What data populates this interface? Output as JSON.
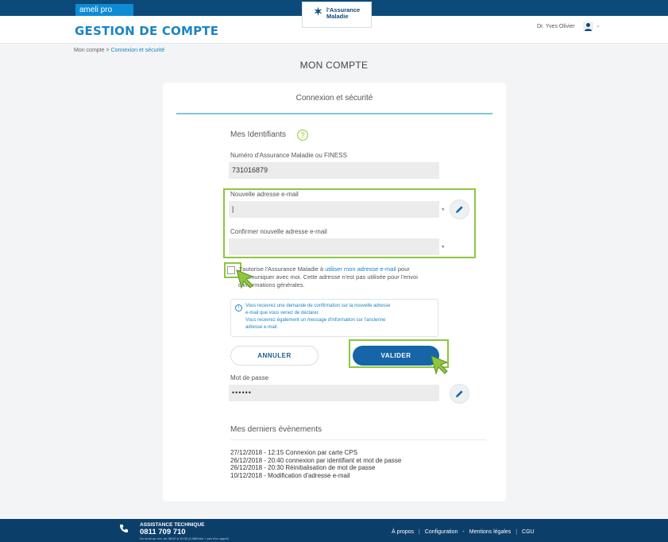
{
  "brand": {
    "tag": "ameli pro",
    "logo_line1": "l'Assurance",
    "logo_line2": "Maladie"
  },
  "header": {
    "title": "GESTION DE COMPTE",
    "user_name": "Dr. Yves Olivier"
  },
  "breadcrumb": {
    "root": "Mon compte",
    "separator": ">",
    "current": "Connexion et sécurité"
  },
  "page_title": "MON COMPTE",
  "card": {
    "title": "Connexion et sécurité",
    "identifiers_label": "Mes Identifiants",
    "help_glyph": "?",
    "number_label": "Numéro d'Assurance Maladie ou FINESS",
    "number_value": "731016879",
    "new_email_label": "Nouvelle adresse e-mail",
    "new_email_value": "|",
    "confirm_email_label": "Confirmer nouvelle adresse e-mail",
    "confirm_email_value": "",
    "required_mark": "*",
    "consent_pre": "J'autorise l'Assurance Maladie à ",
    "consent_link": "utiliser mon adresse e-mail",
    "consent_post": " pour communiquer avec moi. Cette adresse n'est pas utilisée pour l'envoi d'informations générales.",
    "info_glyph": "i",
    "info_line1": "Vous recevrez une demande de confirmation sur la nouvelle adresse",
    "info_line2": "e-mail que vous venez de déclarer.",
    "info_line3": "Vous recevrez également un message d'information sur l'ancienne",
    "info_line4": "adresse e-mail.",
    "cancel_label": "ANNULER",
    "validate_label": "VALIDER",
    "password_label": "Mot de passe",
    "password_value": "••••••",
    "events_title": "Mes derniers évènements",
    "events": [
      "27/12/2018 - 12:15 Connexion par carte CPS",
      "26/12/2018 - 20:40 connexion par identifiant et mot de passe",
      "26/12/2018 - 20:30 Réinitialisation de mot de passe",
      "10/12/2018 - Modification d'adresse e-mail"
    ]
  },
  "footer": {
    "assist_title": "ASSISTANCE TECHNIQUE",
    "assist_phone": "0811 709 710",
    "assist_hours": "Du lundi au ven. de 08:00 à 19:30 (0,06€/min + prix d'un appel)",
    "links": [
      "À propos",
      "Configuration",
      "Mentions légales",
      "CGU"
    ]
  },
  "colors": {
    "brand_blue": "#1a84c5",
    "navy": "#0c3e6a",
    "highlight_green": "#8dc63f",
    "validate_blue": "#1565a8"
  },
  "icons": [
    "user-icon",
    "help-icon",
    "pencil-icon",
    "info-icon",
    "phone-icon",
    "cursor-arrow-icon"
  ]
}
